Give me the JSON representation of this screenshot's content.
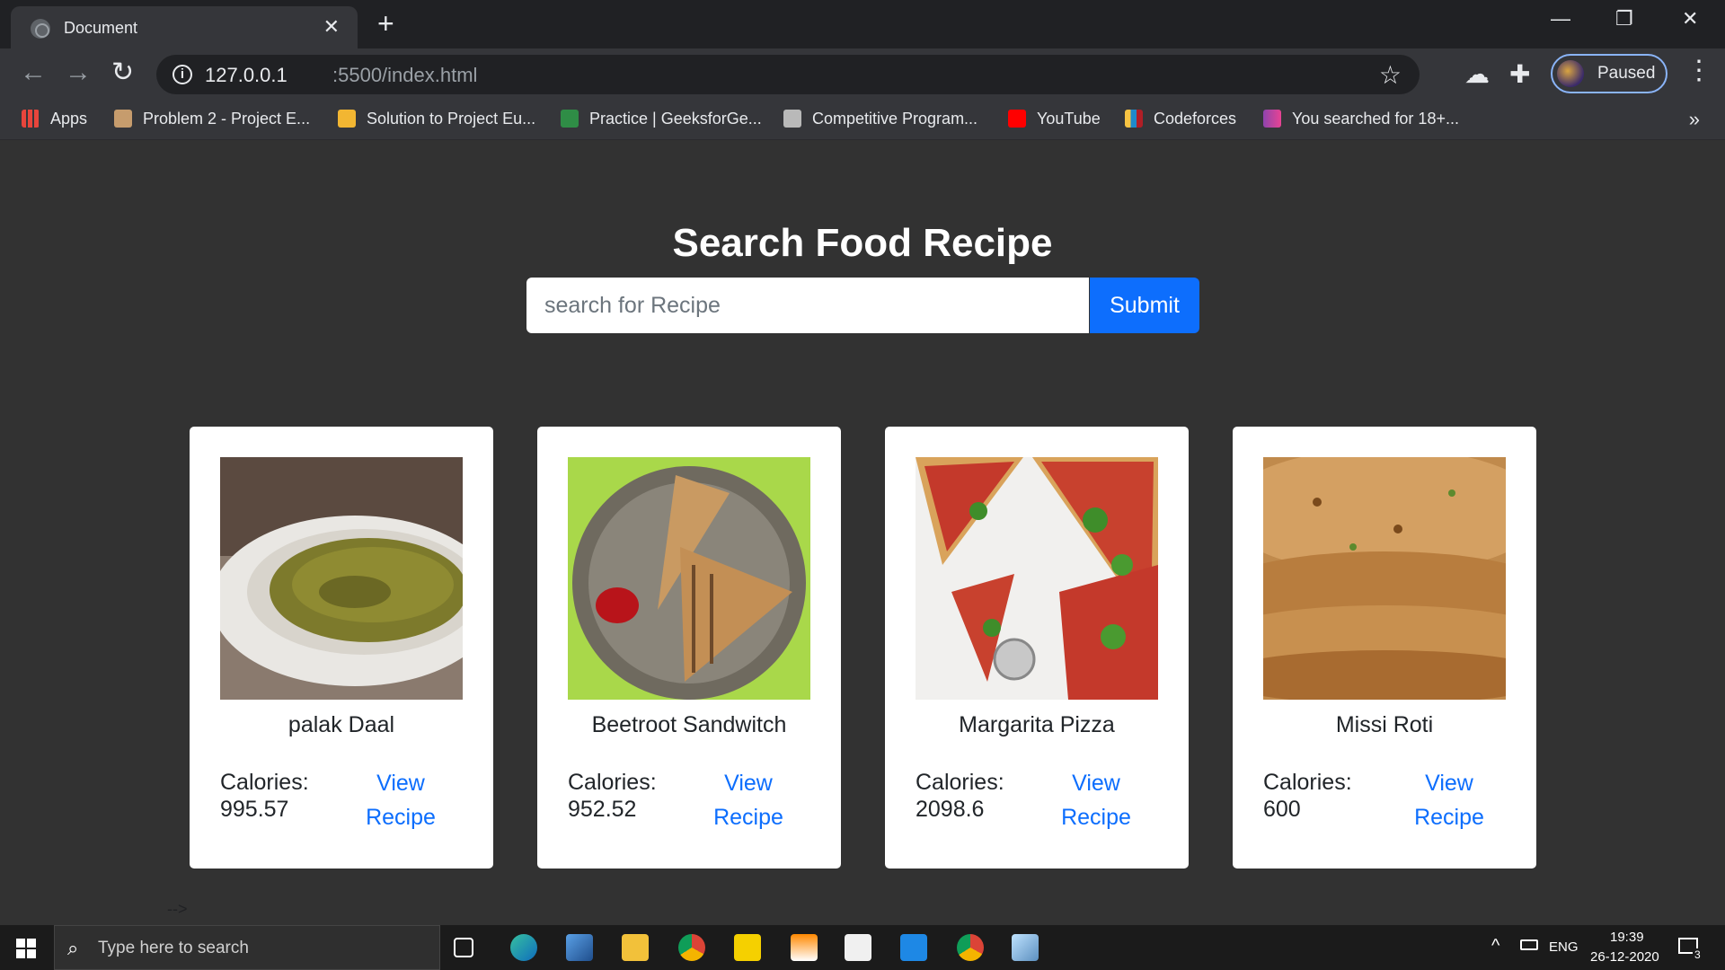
{
  "browser": {
    "tab_title": "Document",
    "tab_close": "✕",
    "new_tab": "+",
    "url_host": "127.0.0.1",
    "url_path": ":5500/index.html",
    "profile_status": "Paused",
    "window_controls": {
      "minimize": "—",
      "restore": "❐",
      "close": "✕"
    },
    "bookmarks": [
      {
        "label": "Apps",
        "icon": "apps-grid-icon",
        "color": "#e8453c"
      },
      {
        "label": "Problem 2 - Project E...",
        "icon": "project-euler-icon",
        "color": "#c69c6d"
      },
      {
        "label": "Solution to Project Eu...",
        "icon": "page-icon",
        "color": "#f2b632"
      },
      {
        "label": "Practice | GeeksforGe...",
        "icon": "geeksforgeeks-icon",
        "color": "#2f8d46"
      },
      {
        "label": "Competitive Program...",
        "icon": "codechef-icon",
        "color": "#b9b9b9"
      },
      {
        "label": "YouTube",
        "icon": "youtube-icon",
        "color": "#ff0000"
      },
      {
        "label": "Codeforces",
        "icon": "codeforces-icon",
        "color": "#f6c343"
      },
      {
        "label": "You searched for 18+...",
        "icon": "bookmark-m-icon",
        "color": "#8e44ad"
      }
    ],
    "bookmarks_more": "»"
  },
  "page": {
    "heading": "Search Food Recipe",
    "search_placeholder": "search for Recipe",
    "submit_label": "Submit",
    "comment_tail": "-->",
    "recipes": [
      {
        "name": "palak Daal",
        "calories_label": "Calories:",
        "calories": "995.57",
        "link_line1": "View",
        "link_line2": "Recipe"
      },
      {
        "name": "Beetroot Sandwitch",
        "calories_label": "Calories:",
        "calories": "952.52",
        "link_line1": "View",
        "link_line2": "Recipe"
      },
      {
        "name": "Margarita Pizza",
        "calories_label": "Calories:",
        "calories": "2098.6",
        "link_line1": "View",
        "link_line2": "Recipe"
      },
      {
        "name": "Missi Roti",
        "calories_label": "Calories:",
        "calories": "600",
        "link_line1": "View",
        "link_line2": "Recipe"
      }
    ]
  },
  "taskbar": {
    "search_placeholder": "Type here to search",
    "language": "ENG",
    "time": "19:39",
    "date": "26-12-2020",
    "notifications": "3"
  },
  "colors": {
    "page_bg": "#323232",
    "accent": "#0d6efd",
    "card_bg": "#ffffff"
  }
}
